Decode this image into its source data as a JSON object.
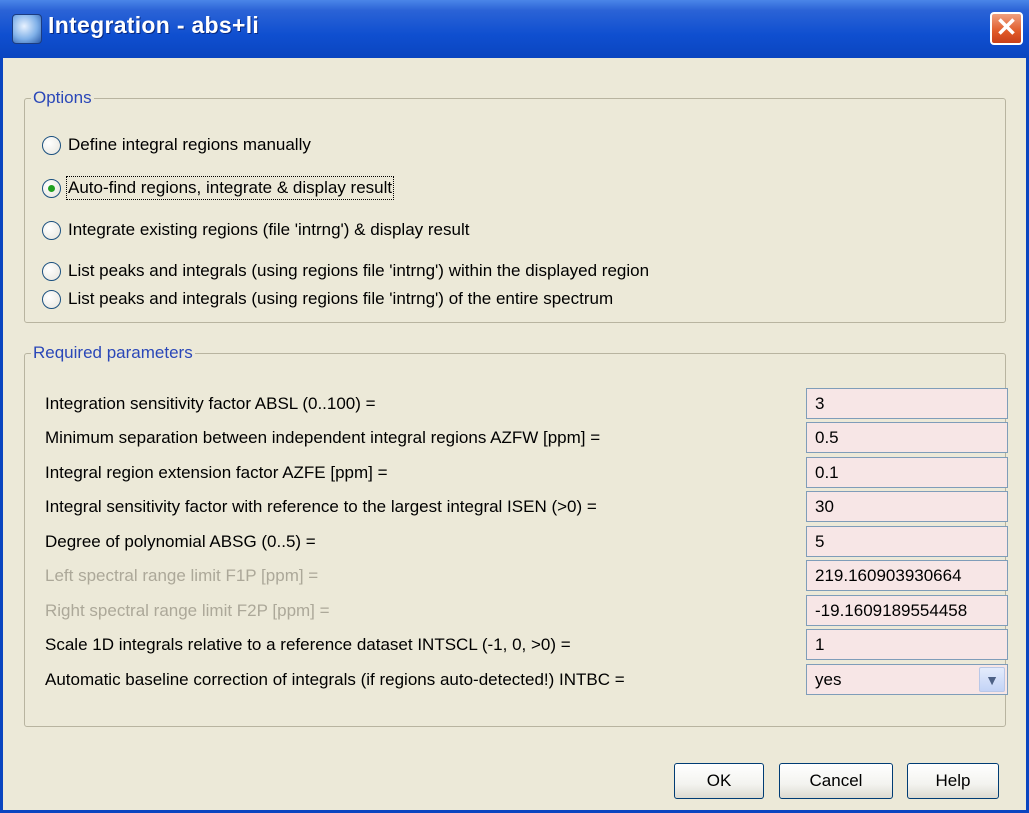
{
  "window": {
    "title": "Integration - abs+li",
    "close_label": "✕",
    "icon": "app-icon"
  },
  "options": {
    "legend": "Options",
    "items": [
      {
        "label": "Define integral regions manually",
        "checked": false
      },
      {
        "label": "Auto-find regions, integrate & display result",
        "checked": true
      },
      {
        "label": "Integrate existing regions (file 'intrng') & display result",
        "checked": false
      },
      {
        "label": "List peaks and integrals (using regions file 'intrng') within the displayed region",
        "checked": false
      },
      {
        "label": "List peaks and integrals (using regions file 'intrng') of the entire spectrum",
        "checked": false
      }
    ]
  },
  "params": {
    "legend": "Required parameters",
    "rows": [
      {
        "label": "Integration sensitivity factor ABSL (0..100) =",
        "value": "3",
        "disabled": false
      },
      {
        "label": "Minimum separation between independent integral regions AZFW [ppm] =",
        "value": "0.5",
        "disabled": false
      },
      {
        "label": "Integral region extension factor AZFE [ppm] =",
        "value": "0.1",
        "disabled": false
      },
      {
        "label": "Integral sensitivity factor with reference to the largest integral ISEN (>0) =",
        "value": "30",
        "disabled": false
      },
      {
        "label": "Degree of polynomial ABSG (0..5) =",
        "value": "5",
        "disabled": false
      },
      {
        "label": "Left spectral range limit F1P [ppm] =",
        "value": "219.160903930664",
        "disabled": true
      },
      {
        "label": "Right spectral range limit F2P [ppm] =",
        "value": "-19.1609189554458",
        "disabled": true
      },
      {
        "label": "Scale 1D integrals relative to a reference dataset INTSCL (-1, 0, >0) =",
        "value": "1",
        "disabled": false
      },
      {
        "label": "Automatic baseline correction of integrals (if regions auto-detected!) INTBC =",
        "value": "yes",
        "disabled": false,
        "type": "select"
      }
    ]
  },
  "buttons": {
    "ok": "OK",
    "cancel": "Cancel",
    "help": "Help"
  },
  "colors": {
    "title_bar": "#0a45c0",
    "legend": "#2a47b8",
    "input_bg": "#f7e6e6",
    "disabled_text": "#aca899"
  }
}
